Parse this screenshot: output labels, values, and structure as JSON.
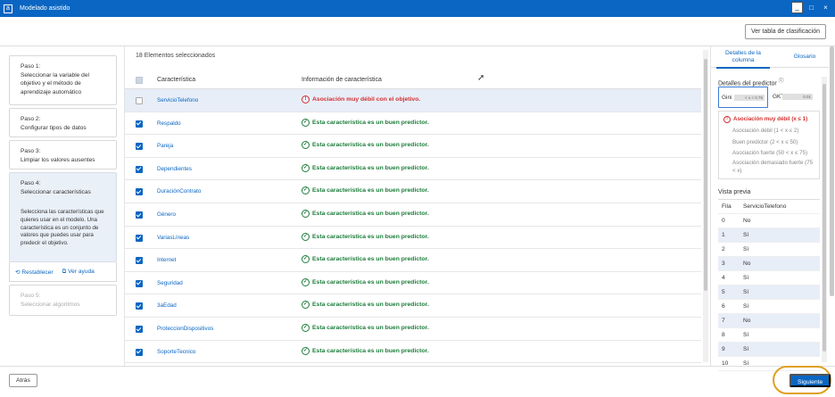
{
  "window": {
    "app_icon": "a",
    "title": "Modelado asistido",
    "controls": [
      "_",
      "□",
      "×"
    ]
  },
  "toolbar": {
    "ver_tabla_label": "Ver tabla de clasificación"
  },
  "steps": {
    "step1": [
      "Paso 1:",
      "Seleccionar la variable del",
      "objetivo y el método de",
      "aprendizaje automático"
    ],
    "step2": [
      "Paso 2:",
      "Configurar tipos de datos"
    ],
    "step3": [
      "Paso 3:",
      "Limpiar los valores ausentes"
    ],
    "step4": [
      "Paso 4:",
      "Seleccionar características"
    ],
    "step4_desc": "Selecciona las características que quieres usar en el modelo. Una característica es un conjunto de valores que puedes usar para predecir el objetivo.",
    "restablecer_label": "Restablecer",
    "ver_ayuda_label": "Ver ayuda",
    "step5": [
      "Paso 5:",
      "Seleccionar algoritmos"
    ]
  },
  "main": {
    "selected_count": "18 Elementos seleccionados",
    "col_feature": "Característica",
    "col_info": "Información de característica",
    "rows": [
      {
        "name": "ServicioTelefono",
        "checked": false,
        "status": "weak",
        "info": "Asociación muy débil con el objetivo."
      },
      {
        "name": "Respaldo",
        "checked": true,
        "status": "good",
        "info": "Esta característica es un buen predictor."
      },
      {
        "name": "Pareja",
        "checked": true,
        "status": "good",
        "info": "Esta característica es un buen predictor."
      },
      {
        "name": "Dependientes",
        "checked": true,
        "status": "good",
        "info": "Esta característica es un buen predictor."
      },
      {
        "name": "DuraciónContrato",
        "checked": true,
        "status": "good",
        "info": "Esta característica es un buen predictor."
      },
      {
        "name": "Género",
        "checked": true,
        "status": "good",
        "info": "Esta característica es un buen predictor."
      },
      {
        "name": "VariasLíneas",
        "checked": true,
        "status": "good",
        "info": "Esta característica es un buen predictor."
      },
      {
        "name": "Internet",
        "checked": true,
        "status": "good",
        "info": "Esta característica es un buen predictor."
      },
      {
        "name": "Seguridad",
        "checked": true,
        "status": "good",
        "info": "Esta característica es un buen predictor."
      },
      {
        "name": "3aEdad",
        "checked": true,
        "status": "good",
        "info": "Esta característica es un buen predictor."
      },
      {
        "name": "ProteccionDispositivos",
        "checked": true,
        "status": "good",
        "info": "Esta característica es un buen predictor."
      },
      {
        "name": "SoporteTecnico",
        "checked": true,
        "status": "good",
        "info": "Esta característica es un buen predictor."
      }
    ]
  },
  "right": {
    "tab_detalles": "Detalles de la columna",
    "tab_glosario": "Glosario",
    "detalles_title": "Detalles del predictor",
    "info_icon": "ⓘ",
    "gini_label": "Gini",
    "gini_value": "< x < 0.76",
    "gkt_label": "GKT",
    "gkt_value": "0.01",
    "legend": [
      "Asociación muy débil (x ≤ 1)",
      "Asociación débil (1 < x ≤ 2)",
      "Buen predictor (2 < x ≤ 50)",
      "Asociación fuerte (50 < x ≤ 75)",
      "Asociación demasiado fuerte (75 < x)"
    ],
    "vista_previa_title": "Vista previa",
    "preview_cols": [
      "Fila",
      "ServicioTelefono"
    ],
    "preview_rows": [
      [
        "0",
        "No"
      ],
      [
        "1",
        "Sí"
      ],
      [
        "2",
        "Sí"
      ],
      [
        "3",
        "No"
      ],
      [
        "4",
        "Sí"
      ],
      [
        "5",
        "Sí"
      ],
      [
        "6",
        "Sí"
      ],
      [
        "7",
        "No"
      ],
      [
        "8",
        "Sí"
      ],
      [
        "9",
        "Sí"
      ],
      [
        "10",
        "Sí"
      ]
    ]
  },
  "footer": {
    "atras_label": "Atrás",
    "siguiente_label": "Siguiente"
  },
  "colors": {
    "accent": "#0a66c2",
    "good": "#1b7d3a",
    "weak": "#d32f2f",
    "highlight_ring": "#e0a020"
  }
}
